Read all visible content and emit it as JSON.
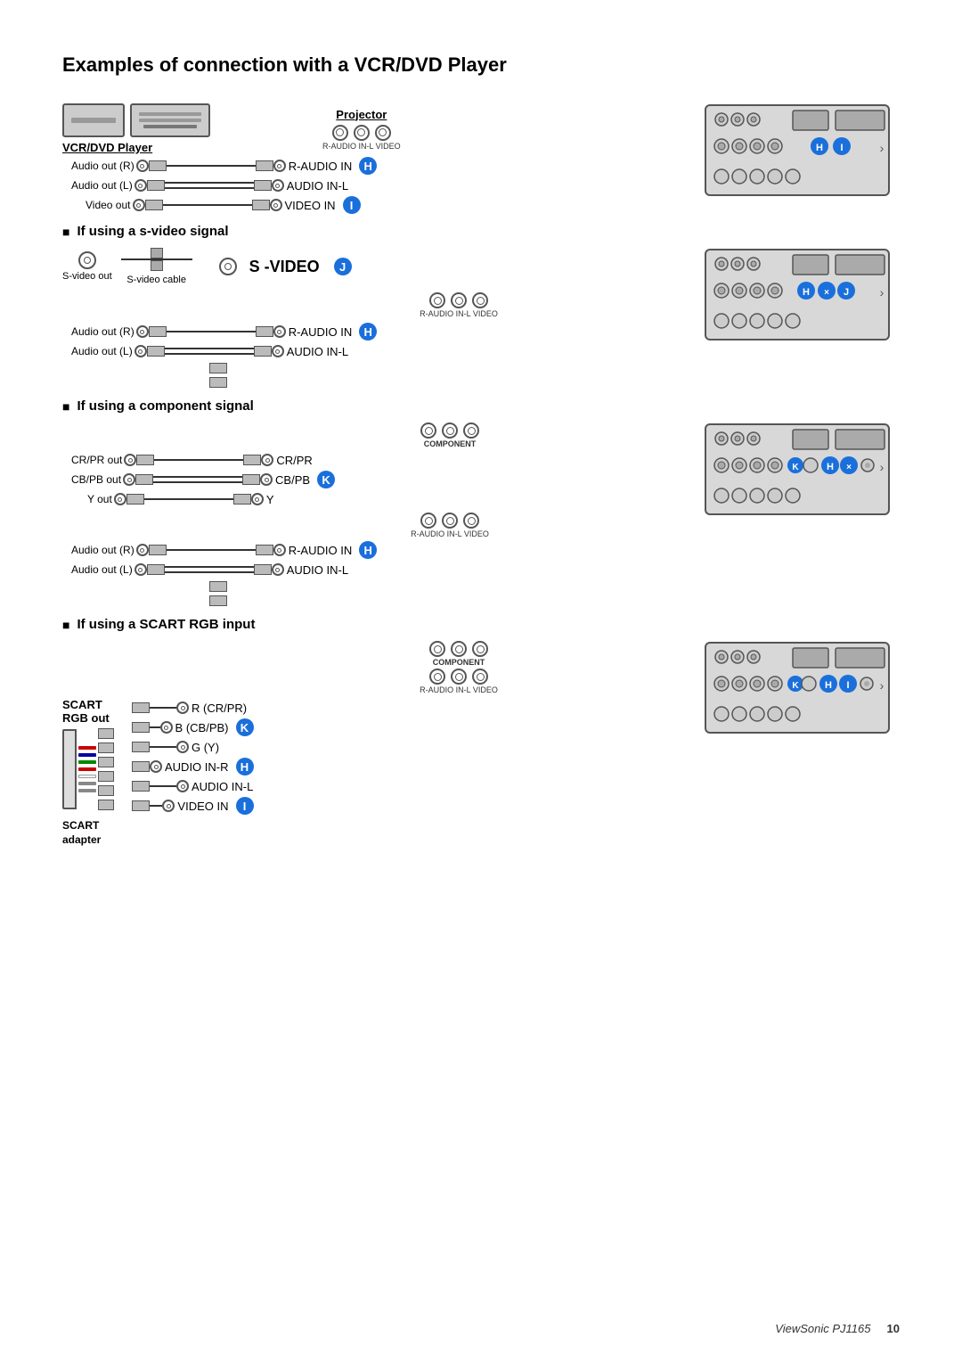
{
  "page": {
    "title": "Examples of connection with a VCR/DVD Player",
    "footer": {
      "brand": "ViewSonic  PJ1165",
      "page": "10"
    }
  },
  "sections": [
    {
      "id": "basic",
      "hasHeader": false,
      "label": "VCR/DVD Player",
      "projectorLabel": "Projector",
      "ports_label": "R-AUDIO IN-L VIDEO",
      "connections": [
        {
          "src": "Audio out (R)",
          "dst": "R-AUDIO IN"
        },
        {
          "src": "Audio out (L)",
          "dst": "AUDIO IN-L"
        },
        {
          "src": "Video out",
          "dst": "VIDEO IN"
        }
      ],
      "badges": [
        "H",
        "I"
      ]
    },
    {
      "id": "svideo",
      "headerText": "If using a s-video signal",
      "svideo": {
        "srcLabel": "S-video out",
        "cableLabel": "S-video cable"
      },
      "signalLabel": "S -VIDEO",
      "ports_label": "R-AUDIO IN-L VIDEO",
      "connections": [
        {
          "src": "Audio out (R)",
          "dst": "R-AUDIO IN"
        },
        {
          "src": "Audio out (L)",
          "dst": "AUDIO IN-L"
        }
      ],
      "badges": [
        "H",
        "J"
      ]
    },
    {
      "id": "component",
      "headerText": "If using a component signal",
      "componentLabel": "COMPONENT",
      "ports_label": "R-AUDIO IN-L VIDEO",
      "componentPorts": [
        {
          "src": "CR/PR out",
          "dst": "CR/PR"
        },
        {
          "src": "CB/PB out",
          "dst": "CB/PB"
        },
        {
          "src": "Y out",
          "dst": "Y"
        }
      ],
      "connections": [
        {
          "src": "Audio out (R)",
          "dst": "R-AUDIO IN"
        },
        {
          "src": "Audio out (L)",
          "dst": "AUDIO IN-L"
        }
      ],
      "badges": [
        "H",
        "K"
      ]
    },
    {
      "id": "scart",
      "headerText": "If using a SCART RGB input",
      "componentLabel": "COMPONENT",
      "audioLabel": "R-AUDIO IN-L VIDEO",
      "scartPorts": [
        {
          "dst": "R (CR/PR)"
        },
        {
          "dst": "B (CB/PB)"
        },
        {
          "dst": "G (Y)"
        },
        {
          "dst": "AUDIO IN-R"
        },
        {
          "dst": "AUDIO IN-L"
        },
        {
          "dst": "VIDEO IN"
        }
      ],
      "srcLabel": "SCART\nRGB out",
      "adapterLabel": "SCART\nadapter",
      "badges": [
        "H",
        "I",
        "K"
      ]
    }
  ],
  "icons": {
    "rca": "○",
    "svideo": "⊙",
    "component": "⊕"
  }
}
